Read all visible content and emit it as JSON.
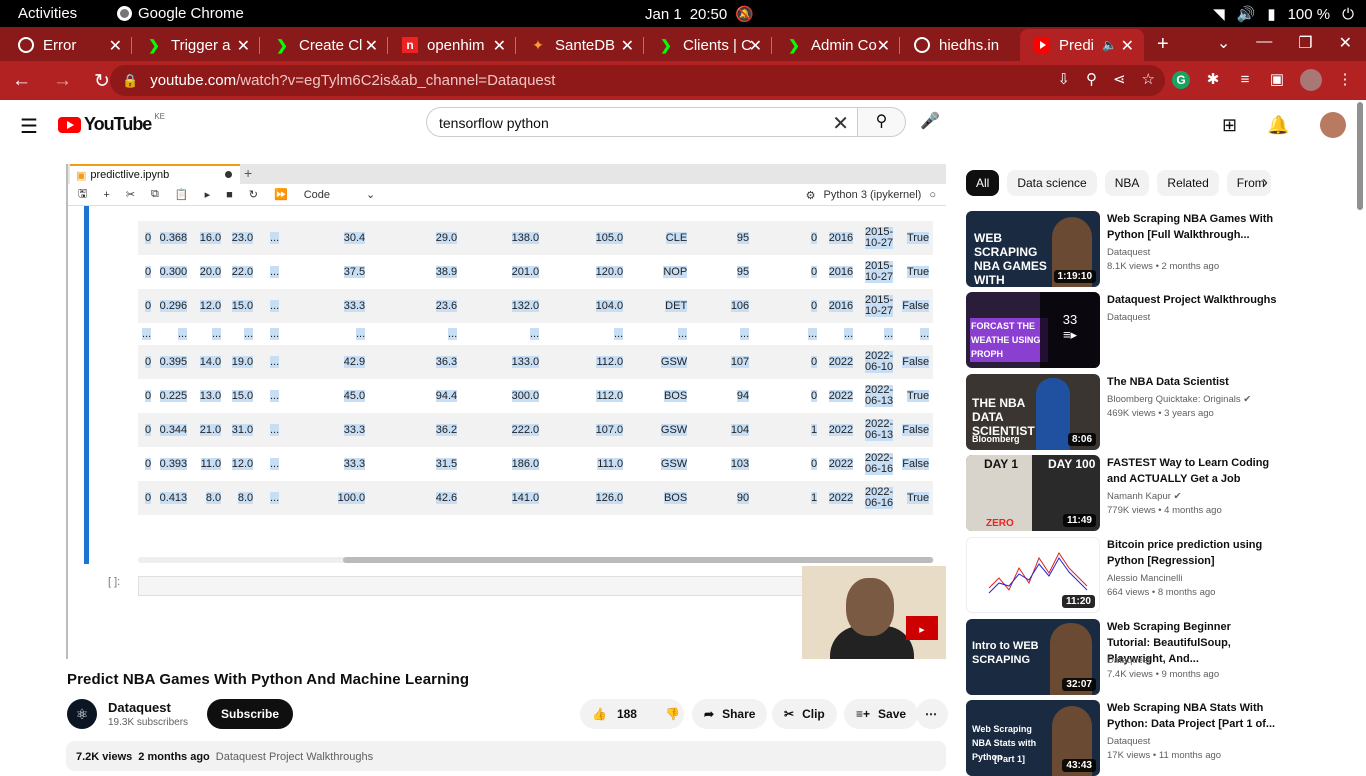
{
  "system": {
    "activities": "Activities",
    "app": "Google Chrome",
    "date": "Jan 1",
    "time": "20:50",
    "battery": "100 %"
  },
  "tabs": [
    {
      "label": "Error"
    },
    {
      "label": "Trigger a"
    },
    {
      "label": "Create Cl"
    },
    {
      "label": "openhim"
    },
    {
      "label": "SanteDB"
    },
    {
      "label": "Clients | C"
    },
    {
      "label": "Admin Co"
    },
    {
      "label": "hiedhs.in"
    },
    {
      "label": "Predi"
    }
  ],
  "omnibox": {
    "url_domain": "youtube.com",
    "url_path": "/watch?v=egTylm6C2is&ab_channel=Dataquest"
  },
  "youtube": {
    "logo": "YouTube",
    "country": "KE",
    "search_value": "tensorflow python"
  },
  "notebook": {
    "tab": "predictlive.ipynb",
    "cell_type": "Code",
    "kernel": "Python 3 (ipykernel)",
    "input_prompt": "[ ]:",
    "rows": [
      [
        "0",
        "0.368",
        "16.0",
        "23.0",
        "...",
        "30.4",
        "29.0",
        "138.0",
        "105.0",
        "CLE",
        "95",
        "0",
        "2016",
        "2015-10-27",
        "True"
      ],
      [
        "0",
        "0.300",
        "20.0",
        "22.0",
        "...",
        "37.5",
        "38.9",
        "201.0",
        "120.0",
        "NOP",
        "95",
        "0",
        "2016",
        "2015-10-27",
        "True"
      ],
      [
        "0",
        "0.296",
        "12.0",
        "15.0",
        "...",
        "33.3",
        "23.6",
        "132.0",
        "104.0",
        "DET",
        "106",
        "0",
        "2016",
        "2015-10-27",
        "False"
      ],
      [
        "...",
        "...",
        "...",
        "...",
        "...",
        "...",
        "...",
        "...",
        "...",
        "...",
        "...",
        "...",
        "...",
        "...",
        "..."
      ],
      [
        "0",
        "0.395",
        "14.0",
        "19.0",
        "...",
        "42.9",
        "36.3",
        "133.0",
        "112.0",
        "GSW",
        "107",
        "0",
        "2022",
        "2022-06-10",
        "False"
      ],
      [
        "0",
        "0.225",
        "13.0",
        "15.0",
        "...",
        "45.0",
        "94.4",
        "300.0",
        "112.0",
        "BOS",
        "94",
        "0",
        "2022",
        "2022-06-13",
        "True"
      ],
      [
        "0",
        "0.344",
        "21.0",
        "31.0",
        "...",
        "33.3",
        "36.2",
        "222.0",
        "107.0",
        "GSW",
        "104",
        "1",
        "2022",
        "2022-06-13",
        "False"
      ],
      [
        "0",
        "0.393",
        "11.0",
        "12.0",
        "...",
        "33.3",
        "31.5",
        "186.0",
        "111.0",
        "GSW",
        "103",
        "0",
        "2022",
        "2022-06-16",
        "False"
      ],
      [
        "0",
        "0.413",
        "8.0",
        "8.0",
        "...",
        "100.0",
        "42.6",
        "141.0",
        "126.0",
        "BOS",
        "90",
        "1",
        "2022",
        "2022-06-16",
        "True"
      ]
    ]
  },
  "video": {
    "title": "Predict NBA Games With Python And Machine Learning",
    "channel": "Dataquest",
    "subscribers": "19.3K subscribers",
    "subscribe": "Subscribe",
    "likes": "188",
    "share": "Share",
    "clip": "Clip",
    "save": "Save",
    "views": "7.2K views",
    "age": "2 months ago",
    "playlist": "Dataquest Project Walkthroughs"
  },
  "chips": [
    "All",
    "Data science",
    "NBA",
    "Related",
    "From"
  ],
  "recommendations": [
    {
      "title": "Web Scraping NBA Games With Python [Full Walkthrough...",
      "channel": "Dataquest",
      "meta": "8.1K views • 2 months ago",
      "duration": "1:19:10",
      "thumb_text": "WEB SCRAPING NBA GAMES WITH PYTHON"
    },
    {
      "title": "Dataquest Project Walkthroughs",
      "channel": "Dataquest",
      "meta": "",
      "duration": "",
      "count": "33",
      "thumb_text": "FORCAST THE WEATHE USING PROPH"
    },
    {
      "title": "The NBA Data Scientist",
      "channel": "Bloomberg Quicktake: Originals",
      "meta": "469K views • 3 years ago",
      "duration": "8:06",
      "thumb_text": "THE NBA DATA SCIENTIST",
      "thumb_brand": "Bloomberg"
    },
    {
      "title": "FASTEST Way to Learn Coding and ACTUALLY Get a Job",
      "channel": "Namanh Kapur",
      "meta": "779K views • 4 months ago",
      "duration": "11:49",
      "thumb_text": "DAY 1",
      "thumb_text2": "DAY 100",
      "thumb_zero": "ZERO"
    },
    {
      "title": "Bitcoin price prediction using Python [Regression]",
      "channel": "Alessio Mancinelli",
      "meta": "664 views • 8 months ago",
      "duration": "11:20"
    },
    {
      "title": "Web Scraping Beginner Tutorial: BeautifulSoup, Playwright, And...",
      "channel": "Dataquest",
      "meta": "7.4K views • 9 months ago",
      "duration": "32:07",
      "thumb_text": "Intro to WEB SCRAPING"
    },
    {
      "title": "Web Scraping NBA Stats With Python: Data Project [Part 1 of...",
      "channel": "Dataquest",
      "meta": "17K views • 11 months ago",
      "duration": "43:43",
      "thumb_text": "Web Scraping NBA Stats with Python",
      "thumb_part": "[Part 1]"
    }
  ],
  "colors": {
    "chrome_tab": "#b22222",
    "chrome_strip": "#8a1a1a",
    "yt_red": "#ff0000",
    "jupyter_blue": "#1976d2"
  }
}
